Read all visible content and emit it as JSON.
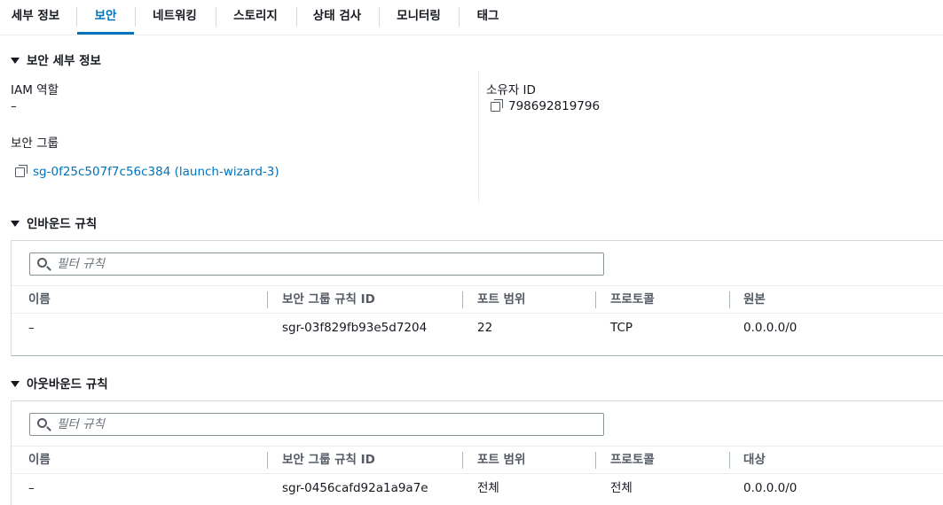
{
  "tabs": [
    "세부 정보",
    "보안",
    "네트워킹",
    "스토리지",
    "상태 검사",
    "모니터링",
    "태그"
  ],
  "active_tab": "보안",
  "security_details": {
    "title": "보안 세부 정보",
    "iam_role_label": "IAM 역할",
    "iam_role_value": "–",
    "owner_id_label": "소유자 ID",
    "owner_id_value": "798692819796",
    "security_group_label": "보안 그룹",
    "security_group_value": "sg-0f25c507f7c56c384 (launch-wizard-3)"
  },
  "inbound": {
    "title": "인바운드 규칙",
    "search_placeholder": "필터 규칙",
    "columns": [
      "이름",
      "보안 그룹 규칙 ID",
      "포트 범위",
      "프로토콜",
      "원본"
    ],
    "rows": [
      [
        "–",
        "sgr-03f829fb93e5d7204",
        "22",
        "TCP",
        "0.0.0.0/0"
      ]
    ]
  },
  "outbound": {
    "title": "아웃바운드 규칙",
    "search_placeholder": "필터 규칙",
    "columns": [
      "이름",
      "보안 그룹 규칙 ID",
      "포트 범위",
      "프로토콜",
      "대상"
    ],
    "rows": [
      [
        "–",
        "sgr-0456cafd92a1a9a7e",
        "전체",
        "전체",
        "0.0.0.0/0"
      ]
    ]
  },
  "colors": {
    "accent": "#0073bb",
    "text": "#16191f",
    "muted": "#545b64",
    "border": "#eaeded"
  },
  "icons": [
    "copy-icon",
    "search-icon",
    "caret-down-icon"
  ]
}
